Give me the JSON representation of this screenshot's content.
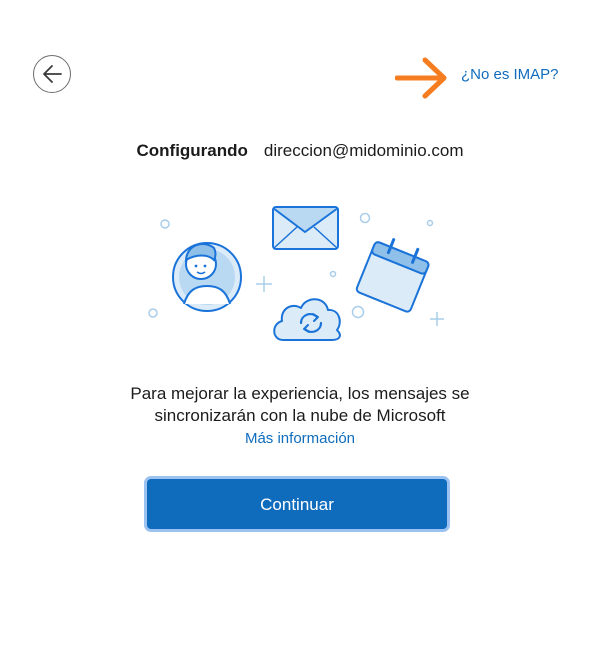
{
  "header": {
    "back_icon": "arrow-left-icon",
    "not_imap_label": "¿No es IMAP?",
    "annotation_arrow_color": "#f57c1f"
  },
  "status": {
    "label": "Configurando",
    "email": "direccion@midominio.com"
  },
  "illustration": {
    "icons": [
      "person-avatar-icon",
      "envelope-icon",
      "calendar-icon",
      "cloud-sync-icon"
    ]
  },
  "message": {
    "line1": "Para mejorar la experiencia, los mensajes se",
    "line2": "sincronizarán con la nube de Microsoft",
    "more_info_label": "Más información"
  },
  "actions": {
    "continue_label": "Continuar",
    "accent_color": "#0f6cbd"
  }
}
